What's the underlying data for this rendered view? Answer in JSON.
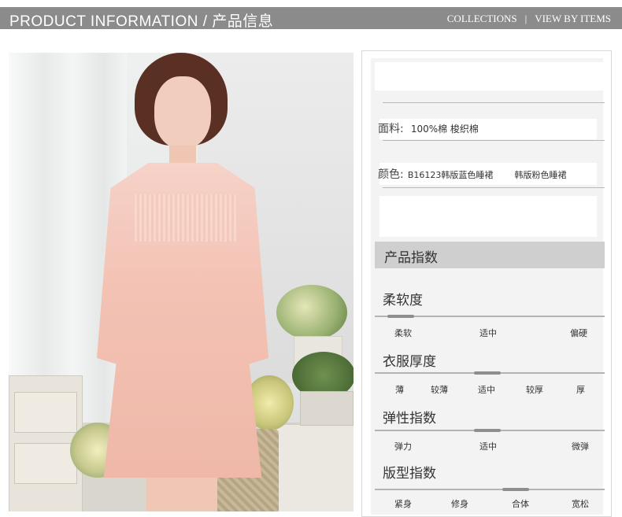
{
  "header": {
    "title": "PRODUCT INFORMATION / 产品信息",
    "nav": [
      "COLLECTIONS",
      "VIEW BY ITEMS"
    ],
    "separator": "|"
  },
  "specs": {
    "material_label": "面料:",
    "material_value": "100%棉  梭织棉",
    "color_label": "颜色:",
    "color_values": [
      "B16123韩版蓝色睡裙",
      "韩版粉色睡裙"
    ]
  },
  "index_header": "产品指数",
  "metrics": [
    {
      "title": "柔软度",
      "ticks": [
        "柔软",
        "适中",
        "偏硬"
      ],
      "level": 0.0
    },
    {
      "title": "衣服厚度",
      "ticks": [
        "薄",
        "较薄",
        "适中",
        "较厚",
        "厚"
      ],
      "level": 0.5
    },
    {
      "title": "弹性指数",
      "ticks": [
        "弹力",
        "适中",
        "微弹"
      ],
      "level": 0.5
    },
    {
      "title": "版型指数",
      "ticks": [
        "紧身",
        "修身",
        "合体",
        "宽松"
      ],
      "level": 0.67
    }
  ],
  "colors": {
    "topbar": "#8b8b8b",
    "header_band": "#cfcfcf",
    "knob": "#8e8e8e"
  }
}
